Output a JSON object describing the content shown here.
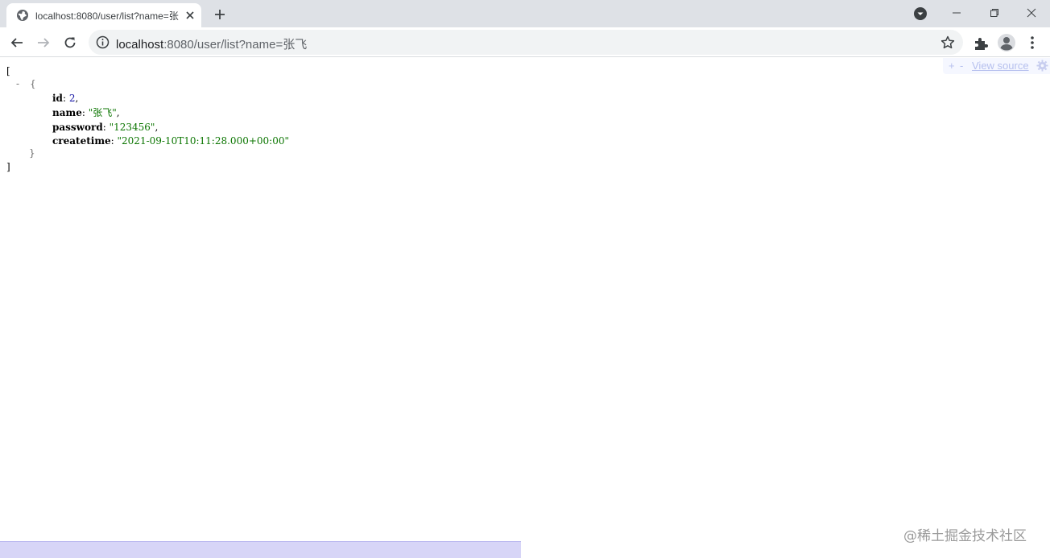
{
  "tab": {
    "title": "localhost:8080/user/list?name=张飞",
    "favicon": "globe-icon"
  },
  "omnibox": {
    "host": "localhost",
    "rest": ":8080/user/list?name=张飞"
  },
  "json": {
    "open_bracket": "[",
    "close_bracket": "]",
    "collapser": "-",
    "open_brace": "{",
    "close_brace": "}",
    "fields": [
      {
        "key": "id",
        "value": "2",
        "kind": "number"
      },
      {
        "key": "name",
        "value": "\"张飞\"",
        "kind": "string"
      },
      {
        "key": "password",
        "value": "\"123456\"",
        "kind": "string"
      },
      {
        "key": "createtime",
        "value": "\"2021-09-10T10:11:28.000+00:00\"",
        "kind": "string"
      }
    ]
  },
  "viewer_bar": {
    "expand_label": "+",
    "collapse_label": "-",
    "view_source_label": "View source"
  },
  "watermark": "@稀土掘金技术社区",
  "colors": {
    "number": "#1a1aa6",
    "string": "#0b7500",
    "tabstrip": "#dee1e6",
    "omnibox": "#f1f3f4"
  }
}
